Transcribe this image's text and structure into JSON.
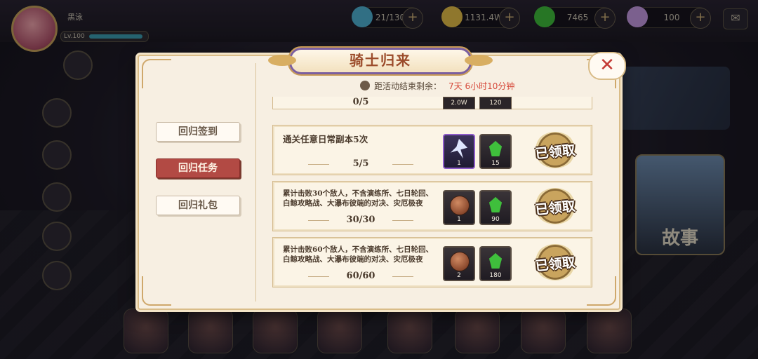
{
  "background": {
    "player": {
      "name": "黑泳",
      "level": "Lv.100"
    },
    "resources": [
      {
        "name": "stamina",
        "value": "21/130",
        "icon": "stamina-orb-icon",
        "color": "#4fb3d6"
      },
      {
        "name": "gold",
        "value": "1131.4W",
        "icon": "gold-coin-icon",
        "color": "#e7c04a"
      },
      {
        "name": "green-gem",
        "value": "7465",
        "icon": "green-gem-icon",
        "color": "#3fbf3c"
      },
      {
        "name": "rainbow-crystal",
        "value": "100",
        "icon": "rainbow-crystal-icon",
        "color": "#c79be6"
      }
    ],
    "story_label": "故事"
  },
  "dialog": {
    "title": "骑士归来",
    "countdown_label": "距活动结束剩余：",
    "countdown_value": "7天 6小时10分钟",
    "tabs": [
      {
        "label": "回归签到",
        "active": false
      },
      {
        "label": "回归任务",
        "active": true
      },
      {
        "label": "回归礼包",
        "active": false
      }
    ],
    "partial_row": {
      "progress": "0/5",
      "rewards": [
        "2.0W",
        "120"
      ]
    },
    "tasks": [
      {
        "description": "通关任意日常副本5次",
        "progress": "5/5",
        "rewards": [
          {
            "icon": "knight-blade-icon",
            "qty": "1",
            "frame": "purple"
          },
          {
            "icon": "green-gem-icon",
            "qty": "15",
            "frame": "dark"
          }
        ],
        "status": "已领取"
      },
      {
        "description": "累计击败30个敌人，不含演练所、七日轮回、白鲸攻略战、大瀑布彼端的对决、灾厄极夜",
        "progress": "30/30",
        "rewards": [
          {
            "icon": "bronze-medal-icon",
            "qty": "1",
            "frame": "dark"
          },
          {
            "icon": "green-gem-icon",
            "qty": "90",
            "frame": "dark"
          }
        ],
        "status": "已领取"
      },
      {
        "description": "累计击败60个敌人，不含演练所、七日轮回、白鲸攻略战、大瀑布彼端的对决、灾厄极夜",
        "progress": "60/60",
        "rewards": [
          {
            "icon": "bronze-medal-icon",
            "qty": "2",
            "frame": "dark"
          },
          {
            "icon": "green-gem-icon",
            "qty": "180",
            "frame": "dark"
          }
        ],
        "status": "已领取"
      }
    ]
  },
  "colors": {
    "accent": "#b24a44",
    "title": "#9b4b2a",
    "countdown": "#d6483a",
    "panel": "#f7efe2"
  }
}
